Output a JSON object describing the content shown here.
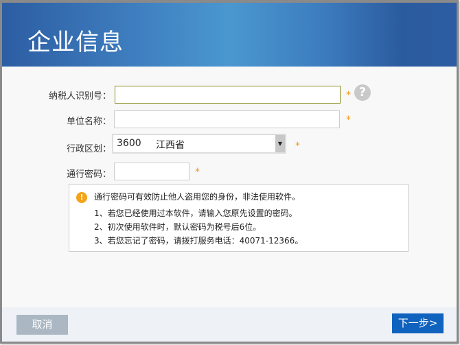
{
  "header": {
    "title": "企业信息"
  },
  "form": {
    "tax_id": {
      "label": "纳税人识别号：",
      "value": ""
    },
    "company_name": {
      "label": "单位名称：",
      "value": ""
    },
    "region": {
      "label": "行政区划：",
      "code": "3600",
      "name": "江西省"
    },
    "password": {
      "label": "通行密码：",
      "value": ""
    },
    "required_mark": "*",
    "help_icon": "?"
  },
  "info": {
    "lines": [
      "通行密码可有效防止他人盗用您的身份，非法使用软件。",
      "1、若您已经使用过本软件，请输入您原先设置的密码。",
      "2、初次使用软件时，默认密码为税号后6位。",
      "3、若您忘记了密码，请拨打服务电话：40071-12366。"
    ],
    "icon": "!"
  },
  "footer": {
    "cancel": "取消",
    "next": "下一步>"
  },
  "colors": {
    "accent": "#0f62bd",
    "required": "#f39a1e",
    "warning": "#f5a31a"
  }
}
